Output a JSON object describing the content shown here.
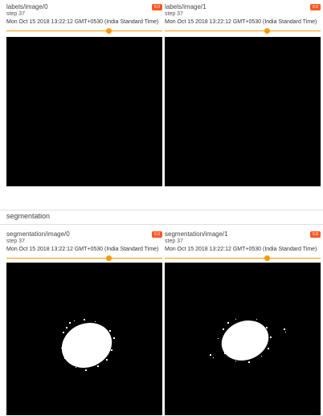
{
  "top_cards": [
    {
      "title": "labels/image/0",
      "step": "step 37",
      "time": "Mon Oct 15 2018 13:22:12 GMT+0530 (India Standard Time)",
      "badge": "0.0"
    },
    {
      "title": "labels/image/1",
      "step": "step 37",
      "time": "Mon Oct 15 2018 13:22:12 GMT+0530 (India Standard Time)",
      "badge": "0.0"
    }
  ],
  "section": {
    "title": "segmentation"
  },
  "bottom_cards": [
    {
      "title": "segmentation/image/0",
      "step": "step 37",
      "time": "Mon Oct 15 2018 13:22:12 GMT+0530 (India Standard Time)",
      "badge": "0.0"
    },
    {
      "title": "segmentation/image/1",
      "step": "step 37",
      "time": "Mon Oct 15 2018 13:22:12 GMT+0530 (India Standard Time)",
      "badge": "0.0"
    }
  ],
  "colors": {
    "accent": "#ff9800",
    "badge": "#ff5722",
    "image_bg": "#000000",
    "blob": "#ffffff"
  }
}
